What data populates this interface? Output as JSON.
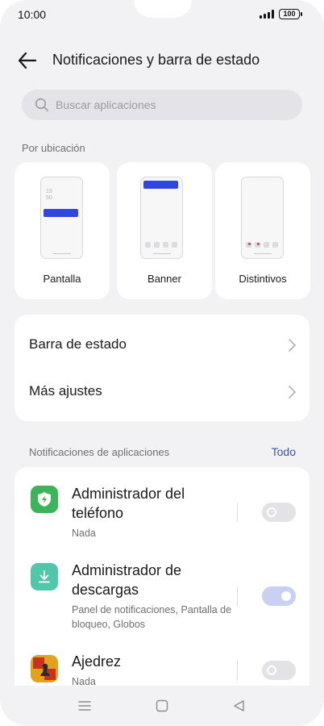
{
  "status_bar": {
    "time": "10:00",
    "battery": "100"
  },
  "header": {
    "title": "Notificaciones y barra de estado"
  },
  "search": {
    "placeholder": "Buscar aplicaciones"
  },
  "location_section": {
    "label": "Por ubicación",
    "options": [
      {
        "label": "Pantalla",
        "preview_time": "19\n50"
      },
      {
        "label": "Banner"
      },
      {
        "label": "Distintivos"
      }
    ]
  },
  "menu": {
    "items": [
      {
        "label": "Barra de estado"
      },
      {
        "label": "Más ajustes"
      }
    ]
  },
  "apps_section": {
    "label": "Notificaciones de aplicaciones",
    "link": "Todo",
    "apps": [
      {
        "name": "Administrador del teléfono",
        "subtitle": "Nada",
        "enabled": false,
        "icon": "shield-bolt-icon",
        "icon_color": "#3cb55a"
      },
      {
        "name": "Administrador de descargas",
        "subtitle": "Panel de notificaciones, Pantalla de bloqueo, Globos",
        "enabled": true,
        "icon": "download-icon",
        "icon_color": "#4fc7a8"
      },
      {
        "name": "Ajedrez",
        "subtitle": "Nada",
        "enabled": false,
        "icon": "chess-icon",
        "icon_color": "#e2a21a"
      }
    ]
  },
  "colors": {
    "accent": "#3553b5",
    "banner": "#2f46e0",
    "badge_dot": "#e0384a"
  }
}
